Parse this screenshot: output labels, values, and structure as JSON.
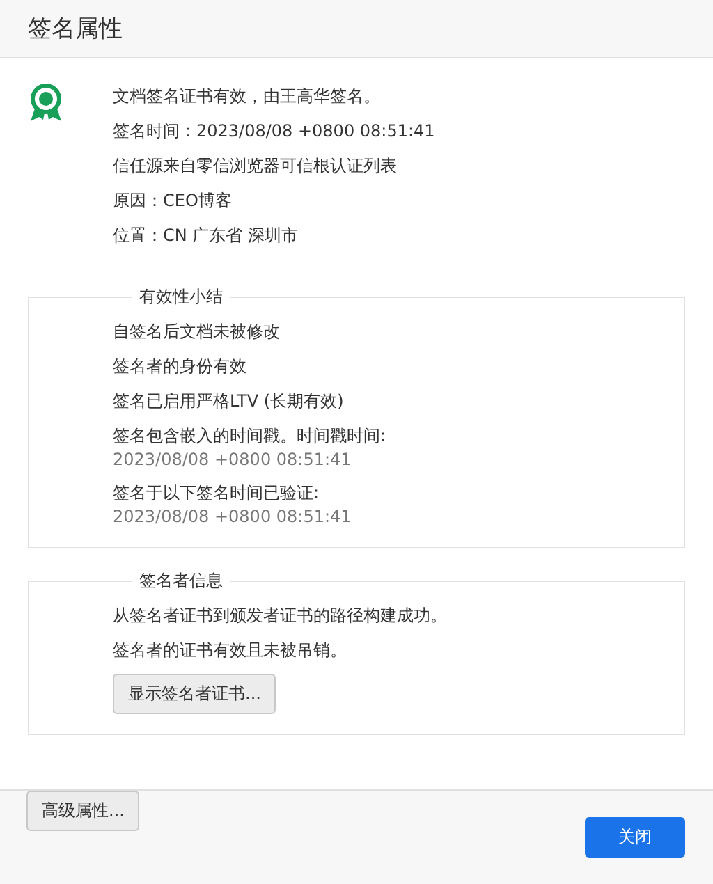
{
  "window": {
    "title": "签名属性"
  },
  "signature": {
    "lines": [
      "文档签名证书有效，由王高华签名。",
      "签名时间：2023/08/08 +0800 08:51:41",
      "信任源来自零信浏览器可信根认证列表",
      "原因：CEO博客",
      "位置：CN 广东省 深圳市"
    ]
  },
  "validity_summary": {
    "title": "有效性小结",
    "items": [
      {
        "text": "自签名后文档未被修改"
      },
      {
        "text": "签名者的身份有效"
      },
      {
        "text": "签名已启用严格LTV (长期有效)"
      },
      {
        "text": "签名包含嵌入的时间戳。时间戳时间:",
        "detail": "2023/08/08 +0800 08:51:41"
      },
      {
        "text": "签名于以下签名时间已验证:",
        "detail": "2023/08/08 +0800 08:51:41"
      }
    ]
  },
  "signer_info": {
    "title": "签名者信息",
    "lines": [
      "从签名者证书到颁发者证书的路径构建成功。",
      "签名者的证书有效且未被吊销。"
    ],
    "button": "显示签名者证书..."
  },
  "footer": {
    "advanced_button": "高级属性...",
    "close_button": "关闭"
  }
}
